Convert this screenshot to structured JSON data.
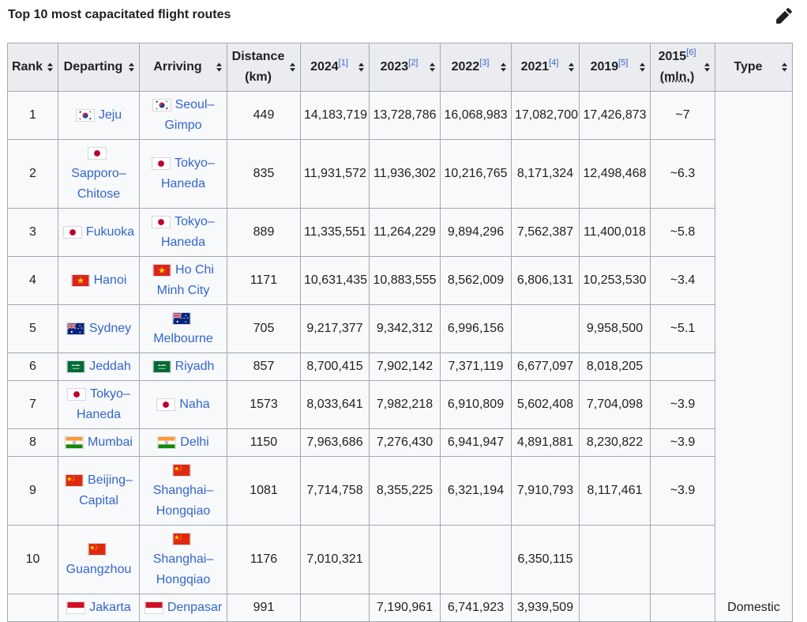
{
  "page": {
    "section_title": "Top 10 most capacitated flight routes"
  },
  "table": {
    "headers": {
      "rank": "Rank",
      "departing": "Departing",
      "arriving": "Arriving",
      "distance_line1": "Distance",
      "distance_line2": "(km)",
      "y2024": "2024",
      "y2024_ref": "[1]",
      "y2023": "2023",
      "y2023_ref": "[2]",
      "y2022": "2022",
      "y2022_ref": "[3]",
      "y2021": "2021",
      "y2021_ref": "[4]",
      "y2019": "2019",
      "y2019_ref": "[5]",
      "y2015": "2015",
      "y2015_ref": "[6]",
      "y2015_unit": "(mln.)",
      "type": "Type"
    },
    "type_value": "Domestic",
    "rows": [
      {
        "rank": "1",
        "dep": "Jeju",
        "dep_flag": "south-korea-flag-icon",
        "arr": "Seoul–Gimpo",
        "arr_flag": "south-korea-flag-icon",
        "distance": "449",
        "y2024": "14,183,719",
        "y2023": "13,728,786",
        "y2022": "16,068,983",
        "y2021": "17,082,700",
        "y2019": "17,426,873",
        "y2015": "~7"
      },
      {
        "rank": "2",
        "dep": "Sapporo–Chitose",
        "dep_flag": "japan-flag-icon",
        "arr": "Tokyo–Haneda",
        "arr_flag": "japan-flag-icon",
        "distance": "835",
        "y2024": "11,931,572",
        "y2023": "11,936,302",
        "y2022": "10,216,765",
        "y2021": "8,171,324",
        "y2019": "12,498,468",
        "y2015": "~6.3"
      },
      {
        "rank": "3",
        "dep": "Fukuoka",
        "dep_flag": "japan-flag-icon",
        "arr": "Tokyo–Haneda",
        "arr_flag": "japan-flag-icon",
        "distance": "889",
        "y2024": "11,335,551",
        "y2023": "11,264,229",
        "y2022": "9,894,296",
        "y2021": "7,562,387",
        "y2019": "11,400,018",
        "y2015": "~5.8"
      },
      {
        "rank": "4",
        "dep": "Hanoi",
        "dep_flag": "vietnam-flag-icon",
        "arr": "Ho Chi Minh City",
        "arr_flag": "vietnam-flag-icon",
        "distance": "1171",
        "y2024": "10,631,435",
        "y2023": "10,883,555",
        "y2022": "8,562,009",
        "y2021": "6,806,131",
        "y2019": "10,253,530",
        "y2015": "~3.4"
      },
      {
        "rank": "5",
        "dep": "Sydney",
        "dep_flag": "australia-flag-icon",
        "arr": "Melbourne",
        "arr_flag": "australia-flag-icon",
        "distance": "705",
        "y2024": "9,217,377",
        "y2023": "9,342,312",
        "y2022": "6,996,156",
        "y2021": "",
        "y2019": "9,958,500",
        "y2015": "~5.1"
      },
      {
        "rank": "6",
        "dep": "Jeddah",
        "dep_flag": "saudi-arabia-flag-icon",
        "arr": "Riyadh",
        "arr_flag": "saudi-arabia-flag-icon",
        "distance": "857",
        "y2024": "8,700,415",
        "y2023": "7,902,142",
        "y2022": "7,371,119",
        "y2021": "6,677,097",
        "y2019": "8,018,205",
        "y2015": ""
      },
      {
        "rank": "7",
        "dep": "Tokyo–Haneda",
        "dep_flag": "japan-flag-icon",
        "arr": "Naha",
        "arr_flag": "japan-flag-icon",
        "distance": "1573",
        "y2024": "8,033,641",
        "y2023": "7,982,218",
        "y2022": "6,910,809",
        "y2021": "5,602,408",
        "y2019": "7,704,098",
        "y2015": "~3.9"
      },
      {
        "rank": "8",
        "dep": "Mumbai",
        "dep_flag": "india-flag-icon",
        "arr": "Delhi",
        "arr_flag": "india-flag-icon",
        "distance": "1150",
        "y2024": "7,963,686",
        "y2023": "7,276,430",
        "y2022": "6,941,947",
        "y2021": "4,891,881",
        "y2019": "8,230,822",
        "y2015": "~3.9"
      },
      {
        "rank": "9",
        "dep": "Beijing–Capital",
        "dep_flag": "china-flag-icon",
        "arr": "Shanghai–Hongqiao",
        "arr_flag": "china-flag-icon",
        "distance": "1081",
        "y2024": "7,714,758",
        "y2023": "8,355,225",
        "y2022": "6,321,194",
        "y2021": "7,910,793",
        "y2019": "8,117,461",
        "y2015": "~3.9"
      },
      {
        "rank": "10",
        "dep": "Guangzhou",
        "dep_flag": "china-flag-icon",
        "arr": "Shanghai–Hongqiao",
        "arr_flag": "china-flag-icon",
        "distance": "1176",
        "y2024": "7,010,321",
        "y2023": "",
        "y2022": "",
        "y2021": "6,350,115",
        "y2019": "",
        "y2015": ""
      },
      {
        "rank": "",
        "dep": "Jakarta",
        "dep_flag": "indonesia-flag-icon",
        "arr": "Denpasar",
        "arr_flag": "indonesia-flag-icon",
        "distance": "991",
        "y2024": "",
        "y2023": "7,190,961",
        "y2022": "6,741,923",
        "y2021": "3,939,509",
        "y2019": "",
        "y2015": ""
      }
    ]
  },
  "colors": {
    "link": "#3366cc",
    "header_bg": "#eaecf0",
    "cell_bg": "#f8f9fa",
    "border": "#a2a9b1"
  }
}
